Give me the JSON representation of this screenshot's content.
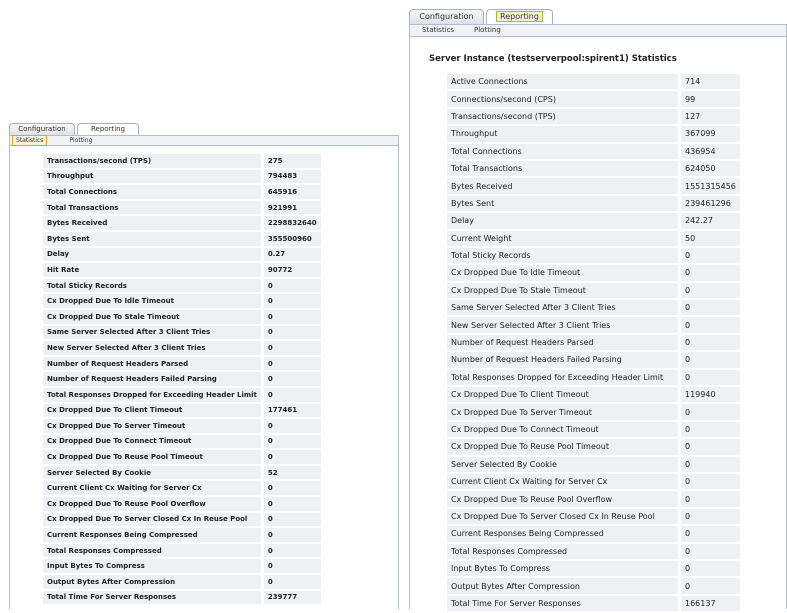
{
  "left_panel": {
    "tabs": [
      "Configuration",
      "Reporting"
    ],
    "active_tab": "Reporting",
    "subtabs": [
      "Statistics",
      "Plotting"
    ],
    "active_subtab": "Statistics",
    "rows": [
      {
        "label": "Transactions/second (TPS)",
        "value": "275"
      },
      {
        "label": "Throughput",
        "value": "794483"
      },
      {
        "label": "Total Connections",
        "value": "645916"
      },
      {
        "label": "Total Transactions",
        "value": "921991"
      },
      {
        "label": "Bytes Received",
        "value": "2298832640"
      },
      {
        "label": "Bytes Sent",
        "value": "355500960"
      },
      {
        "label": "Delay",
        "value": "0.27"
      },
      {
        "label": "Hit Rate",
        "value": "90772"
      },
      {
        "label": "Total Sticky Records",
        "value": "0"
      },
      {
        "label": "Cx Dropped Due To Idle Timeout",
        "value": "0"
      },
      {
        "label": "Cx Dropped Due To Stale Timeout",
        "value": "0"
      },
      {
        "label": "Same Server Selected After 3 Client Tries",
        "value": "0"
      },
      {
        "label": "New Server Selected After 3 Client Tries",
        "value": "0"
      },
      {
        "label": "Number of Request Headers Parsed",
        "value": "0"
      },
      {
        "label": "Number of Request Headers Failed Parsing",
        "value": "0"
      },
      {
        "label": "Total Responses Dropped for Exceeding Header Limit",
        "value": "0"
      },
      {
        "label": "Cx Dropped Due To Client Timeout",
        "value": "177461"
      },
      {
        "label": "Cx Dropped Due To Server Timeout",
        "value": "0"
      },
      {
        "label": "Cx Dropped Due To Connect Timeout",
        "value": "0"
      },
      {
        "label": "Cx Dropped Due To Reuse Pool Timeout",
        "value": "0"
      },
      {
        "label": "Server Selected By Cookie",
        "value": "52"
      },
      {
        "label": "Current Client Cx Waiting for Server Cx",
        "value": "0"
      },
      {
        "label": "Cx Dropped Due To Reuse Pool Overflow",
        "value": "0"
      },
      {
        "label": "Cx Dropped Due To Server Closed Cx In Reuse Pool",
        "value": "0"
      },
      {
        "label": "Current Responses Being Compressed",
        "value": "0"
      },
      {
        "label": "Total Responses Compressed",
        "value": "0"
      },
      {
        "label": "Input Bytes To Compress",
        "value": "0"
      },
      {
        "label": "Output Bytes After Compression",
        "value": "0"
      },
      {
        "label": "Total Time For Server Responses",
        "value": "239777"
      }
    ]
  },
  "right_panel": {
    "tabs": [
      "Configuration",
      "Reporting"
    ],
    "active_tab": "Reporting",
    "subtabs": [
      "Statistics",
      "Plotting"
    ],
    "title": "Server Instance (testserverpool:spirent1) Statistics",
    "rows": [
      {
        "label": "Active Connections",
        "value": "714"
      },
      {
        "label": "Connections/second (CPS)",
        "value": "99"
      },
      {
        "label": "Transactions/second (TPS)",
        "value": "127"
      },
      {
        "label": "Throughput",
        "value": "367099"
      },
      {
        "label": "Total Connections",
        "value": "436954"
      },
      {
        "label": "Total Transactions",
        "value": "624050"
      },
      {
        "label": "Bytes Received",
        "value": "1551315456"
      },
      {
        "label": "Bytes Sent",
        "value": "239461296"
      },
      {
        "label": "Delay",
        "value": "242.27"
      },
      {
        "label": "Current Weight",
        "value": "50"
      },
      {
        "label": "Total Sticky Records",
        "value": "0"
      },
      {
        "label": "Cx Dropped Due To Idle Timeout",
        "value": "0"
      },
      {
        "label": "Cx Dropped Due To Stale Timeout",
        "value": "0"
      },
      {
        "label": "Same Server Selected After 3 Client Tries",
        "value": "0"
      },
      {
        "label": "New Server Selected After 3 Client Tries",
        "value": "0"
      },
      {
        "label": "Number of Request Headers Parsed",
        "value": "0"
      },
      {
        "label": "Number of Request Headers Failed Parsing",
        "value": "0"
      },
      {
        "label": "Total Responses Dropped for Exceeding Header Limit",
        "value": "0"
      },
      {
        "label": "Cx Dropped Due To Client Timeout",
        "value": "119940"
      },
      {
        "label": "Cx Dropped Due To Server Timeout",
        "value": "0"
      },
      {
        "label": "Cx Dropped Due To Connect Timeout",
        "value": "0"
      },
      {
        "label": "Cx Dropped Due To Reuse Pool Timeout",
        "value": "0"
      },
      {
        "label": "Server Selected By Cookie",
        "value": "0"
      },
      {
        "label": "Current Client Cx Waiting for Server Cx",
        "value": "0"
      },
      {
        "label": "Cx Dropped Due To Reuse Pool Overflow",
        "value": "0"
      },
      {
        "label": "Cx Dropped Due To Server Closed Cx In Reuse Pool",
        "value": "0"
      },
      {
        "label": "Current Responses Being Compressed",
        "value": "0"
      },
      {
        "label": "Total Responses Compressed",
        "value": "0"
      },
      {
        "label": "Input Bytes To Compress",
        "value": "0"
      },
      {
        "label": "Output Bytes After Compression",
        "value": "0"
      },
      {
        "label": "Total Time For Server Responses",
        "value": "166137"
      }
    ]
  }
}
